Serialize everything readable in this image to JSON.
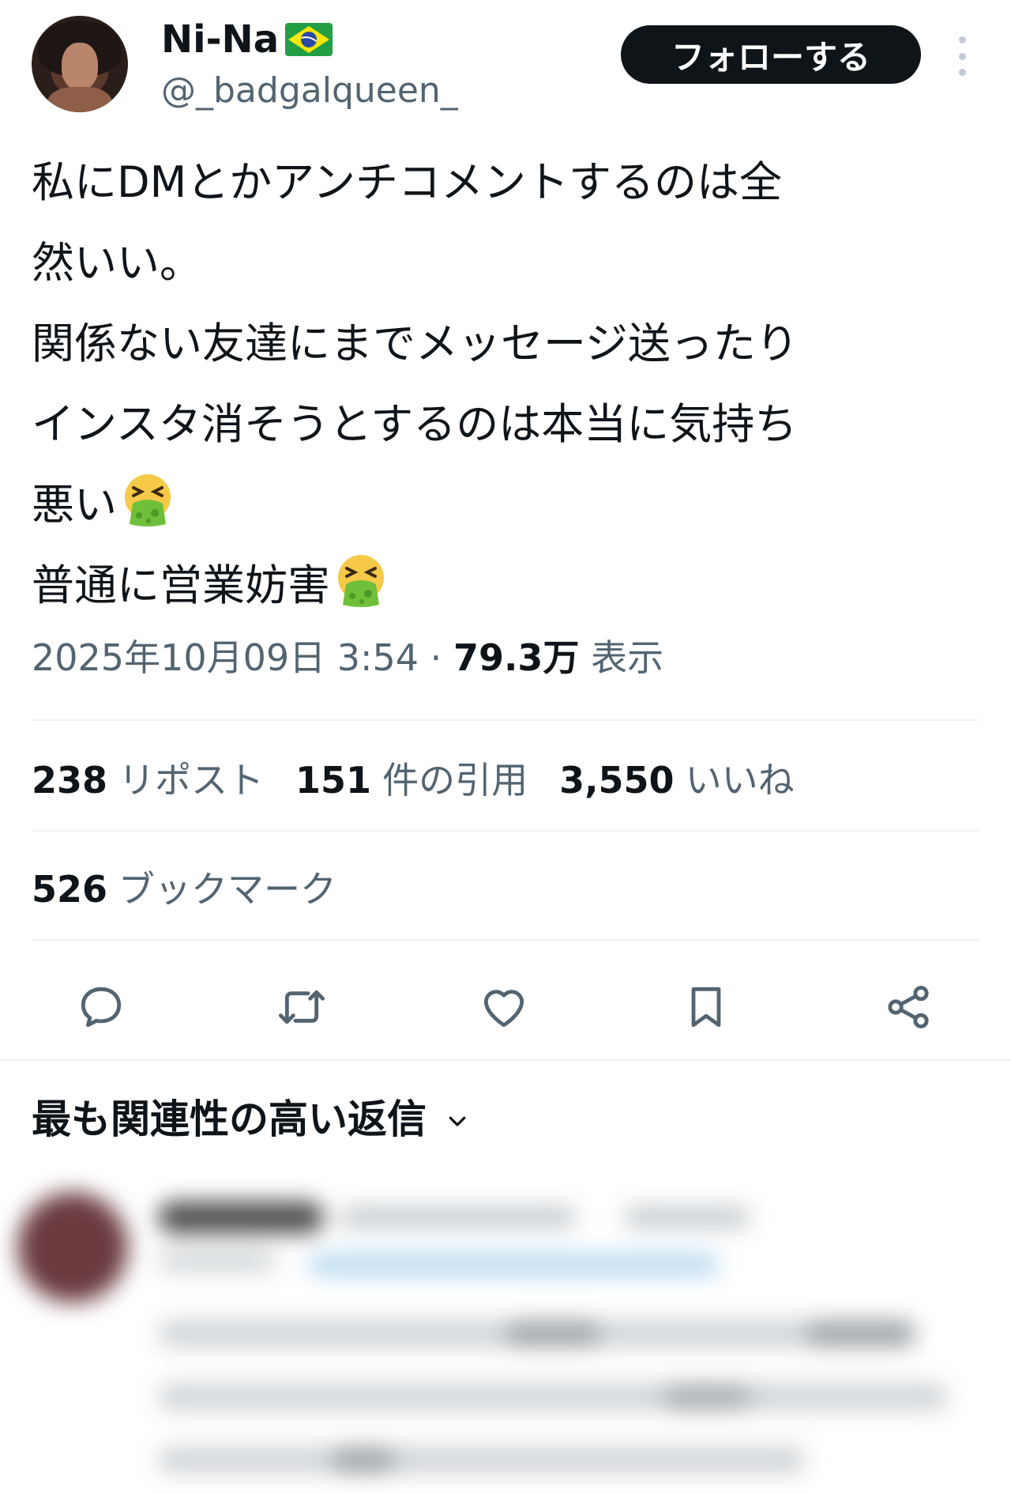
{
  "author": {
    "display_name": "Ni-Na",
    "flag_icon": "brazil-flag-icon",
    "handle": "@_badgalqueen_"
  },
  "follow_label": "フォローする",
  "tweet": {
    "lines": [
      "私にDMとかアンチコメントするのは全",
      "然いい。",
      "関係ない友達にまでメッセージ送ったり",
      "インスタ消そうとするのは本当に気持ち",
      "悪い",
      "普通に営業妨害"
    ],
    "emoji": "face-vomiting-emoji"
  },
  "meta": {
    "timestamp": "2025年10月09日 3:54",
    "separator": " · ",
    "views_count": "79.3万",
    "views_label": "表示"
  },
  "stats": {
    "reposts": {
      "count": "238",
      "label": "リポスト"
    },
    "quotes": {
      "count": "151",
      "label": "件の引用"
    },
    "likes": {
      "count": "3,550",
      "label": "いいね"
    },
    "bookmarks": {
      "count": "526",
      "label": "ブックマーク"
    }
  },
  "actions": [
    "reply-icon",
    "repost-icon",
    "like-icon",
    "bookmark-icon",
    "share-icon"
  ],
  "replies_section": {
    "title": "最も関連性の高い返信",
    "chevron": "chevron-down-icon"
  },
  "colors": {
    "primary_text": "#0f1419",
    "secondary_text": "#536471",
    "divider": "#eff3f4",
    "button_bg": "#0f1419"
  }
}
